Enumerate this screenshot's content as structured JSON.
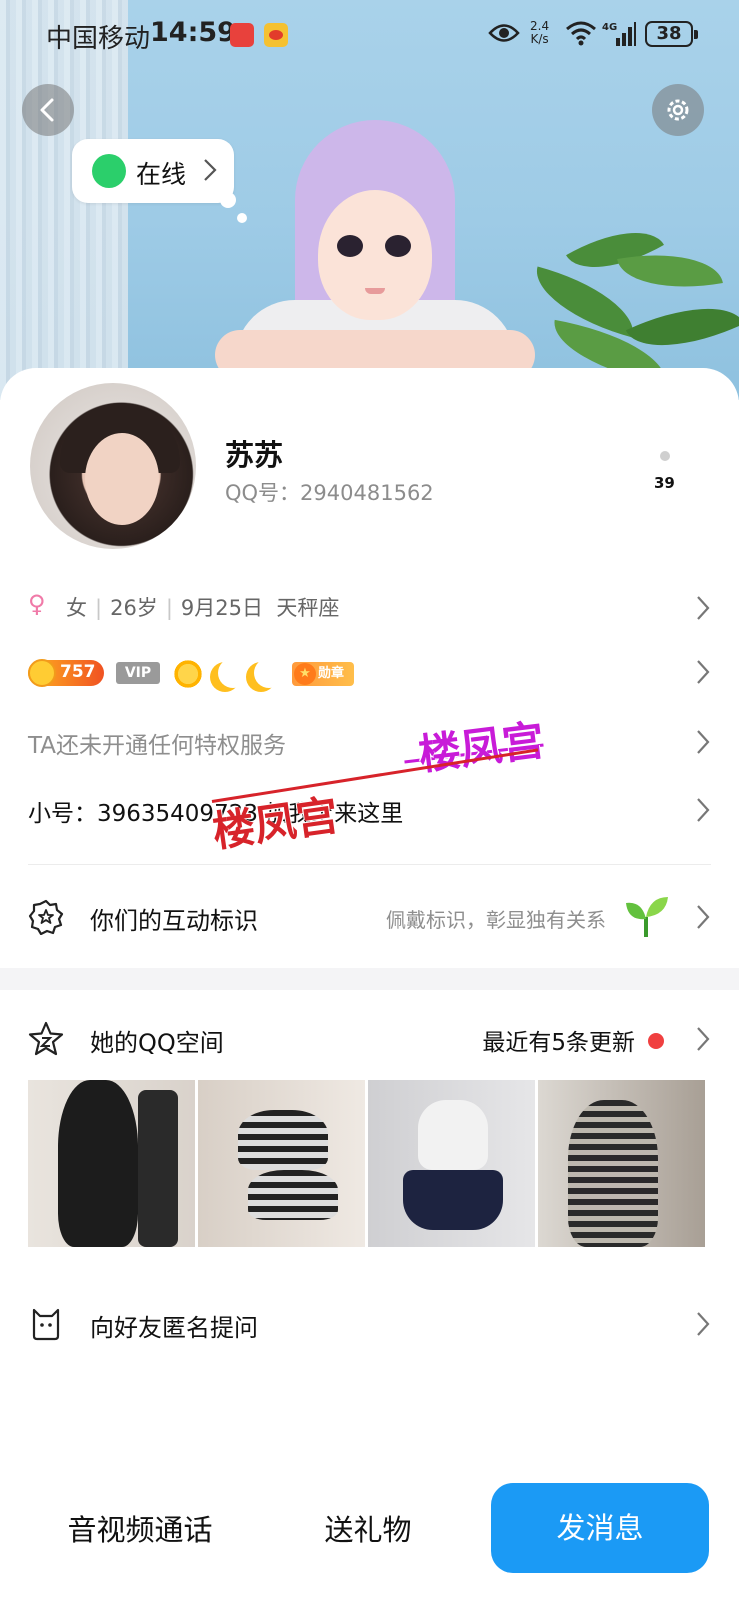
{
  "status_bar": {
    "carrier": "中国移动",
    "time": "14:59",
    "net_speed_value": "2.4",
    "net_speed_unit": "K/s",
    "signal_label": "4G",
    "battery": "38"
  },
  "hero": {
    "online_label": "在线"
  },
  "profile": {
    "nickname": "苏苏",
    "qq_number": "QQ号：2940481562",
    "badge_count": "39"
  },
  "info": {
    "gender": "女",
    "age": "26岁",
    "birthday": "9月25日",
    "zodiac": "天秤座"
  },
  "badges": {
    "level": "757",
    "vip": "VIP",
    "medal": "勋章"
  },
  "privilege": {
    "text": "TA还未开通任何特权服务"
  },
  "alt_account": {
    "text": "小号：39635409723 加我上来这里"
  },
  "watermarks": [
    "楼凤宫",
    "楼凤宫"
  ],
  "interaction": {
    "label": "你们的互动标识",
    "hint": "佩戴标识，彰显独有关系"
  },
  "qzone": {
    "label": "她的QQ空间",
    "update": "最近有5条更新"
  },
  "ask": {
    "label": "向好友匿名提问"
  },
  "actions": {
    "call": "音视频通话",
    "gift": "送礼物",
    "message": "发消息"
  },
  "colors": {
    "accent": "#1b9af5",
    "online": "#2bcf6b",
    "update_dot": "#f04040"
  }
}
